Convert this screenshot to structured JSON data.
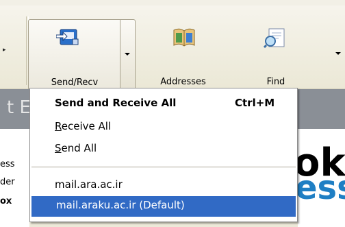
{
  "toolbar": {
    "send_recv": {
      "label": "Send/Recv",
      "icon": "send-receive-icon"
    },
    "addresses": {
      "label": "Addresses",
      "icon": "address-book-icon"
    },
    "find": {
      "label": "Find",
      "icon": "find-icon"
    }
  },
  "background": {
    "band_peek": "t E",
    "left_pane": [
      "ess",
      "der",
      "ox"
    ],
    "logo_top": "ok",
    "logo_bottom": "ess"
  },
  "menu": {
    "items": [
      {
        "label": "Send and Receive All",
        "shortcut": "Ctrl+M",
        "bold": true
      },
      {
        "label": "Receive All",
        "mnemonic": "R"
      },
      {
        "label": "Send All",
        "mnemonic": "S"
      },
      {
        "label": "mail.ara.ac.ir"
      },
      {
        "label": "mail.araku.ac.ir (Default)",
        "highlighted": true
      }
    ],
    "colors": {
      "highlight": "#316ac5",
      "highlight_text": "#ffffff"
    }
  }
}
